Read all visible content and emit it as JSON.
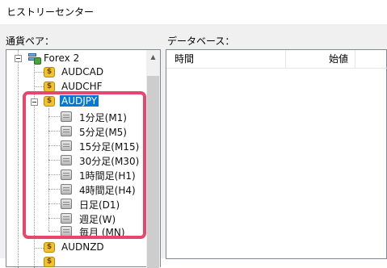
{
  "window": {
    "title": "ヒストリーセンター"
  },
  "symbols_panel": {
    "label": "通貨ペア："
  },
  "database_panel": {
    "label": "データベース：",
    "columns": [
      "時間",
      "始値"
    ]
  },
  "tree": {
    "server": "Forex 2",
    "symbols_before": [
      "AUDCAD",
      "AUDCHF"
    ],
    "selected_symbol": "AUDJPY",
    "timeframes": [
      "1分足(M1)",
      "5分足(M5)",
      "15分足(M15)",
      "30分足(M30)",
      "1時間足(H1)",
      "4時間足(H4)",
      "日足(D1)",
      "週足(W)",
      "毎月 (MN)"
    ],
    "symbols_after": [
      "AUDNZD"
    ]
  },
  "colors": {
    "highlight": "#e8476d",
    "selection": "#0078d7"
  }
}
